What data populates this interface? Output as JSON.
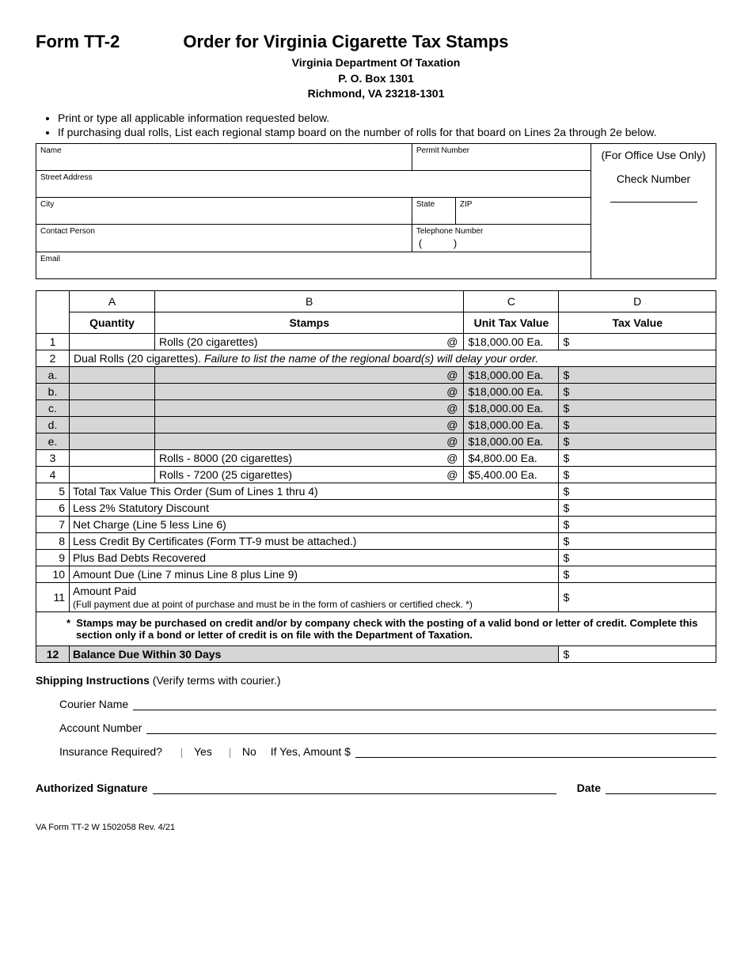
{
  "header": {
    "form_num": "Form TT-2",
    "title": "Order for Virginia Cigarette Tax Stamps",
    "dept": "Virginia Department Of Taxation",
    "pobox": "P. O. Box 1301",
    "citystate": "Richmond, VA  23218-1301"
  },
  "bullets": [
    "Print or type all applicable information requested below.",
    "If purchasing dual rolls, List each regional stamp board on the number of rolls for that board on Lines 2a through 2e below."
  ],
  "info_labels": {
    "name": "Name",
    "permit": "Permit Number",
    "office": "(For Office Use Only)",
    "check": "Check Number",
    "street": "Street Address",
    "city": "City",
    "state": "State",
    "zip": "ZIP",
    "contact": "Contact Person",
    "phone": "Telephone Number",
    "email": "Email"
  },
  "cols": {
    "A": "A",
    "B": "B",
    "C": "C",
    "D": "D",
    "qty": "Quantity",
    "stamps": "Stamps",
    "unit": "Unit Tax Value",
    "tax": "Tax Value"
  },
  "rows": {
    "r1": {
      "num": "1",
      "stamps": "Rolls (20 cigarettes)",
      "unit": "$18,000.00 Ea.",
      "d": "$"
    },
    "r2": {
      "num": "2",
      "text_a": "Dual Rolls (20 cigarettes).  ",
      "text_b": "Failure to list the name of the regional board(s) will delay your order."
    },
    "ra": {
      "num": "a.",
      "unit": "$18,000.00 Ea.",
      "d": "$"
    },
    "rb": {
      "num": "b.",
      "unit": "$18,000.00 Ea.",
      "d": "$"
    },
    "rc": {
      "num": "c.",
      "unit": "$18,000.00 Ea.",
      "d": "$"
    },
    "rd": {
      "num": "d.",
      "unit": "$18,000.00 Ea.",
      "d": "$"
    },
    "re": {
      "num": "e.",
      "unit": "$18,000.00 Ea.",
      "d": "$"
    },
    "r3": {
      "num": "3",
      "stamps": "Rolls - 8000 (20 cigarettes)",
      "unit": "$4,800.00 Ea.",
      "d": "$"
    },
    "r4": {
      "num": "4",
      "stamps": "Rolls - 7200 (25 cigarettes)",
      "unit": "$5,400.00 Ea.",
      "d": "$"
    },
    "r5": {
      "num": "5",
      "label": "Total Tax Value This Order (Sum of Lines 1 thru 4)",
      "d": "$"
    },
    "r6": {
      "num": "6",
      "label": "Less 2% Statutory Discount",
      "d": "$"
    },
    "r7": {
      "num": "7",
      "label": "Net Charge (Line 5 less Line 6)",
      "d": "$"
    },
    "r8": {
      "num": "8",
      "label": "Less Credit By Certificates (Form TT-9 must be attached.)",
      "d": "$"
    },
    "r9": {
      "num": "9",
      "label": "Plus Bad Debts Recovered",
      "d": "$"
    },
    "r10": {
      "num": "10",
      "label": "Amount Due (Line 7 minus Line 8 plus Line 9)",
      "d": "$"
    },
    "r11": {
      "num": "11",
      "label": "Amount Paid",
      "sub": "(Full payment due at point of purchase and must be in the form of cashiers or certified check. *)",
      "d": "$"
    },
    "note": "Stamps may be purchased on credit and/or by company check with the posting of a valid bond or letter of credit. Complete this section only if a bond or letter of credit is on file with the Department of Taxation.",
    "r12": {
      "num": "12",
      "label": "Balance Due Within 30 Days",
      "d": "$"
    }
  },
  "ship": {
    "head_a": "Shipping Instructions ",
    "head_b": "(Verify terms with courier.)",
    "courier": "Courier Name",
    "account": "Account Number",
    "ins": "Insurance Required?",
    "yes": "Yes",
    "no": "No",
    "ifyes": "If Yes, Amount  $"
  },
  "sig": {
    "auth": "Authorized Signature",
    "date": "Date"
  },
  "footer": "VA Form  TT-2 W    1502058    Rev. 4/21"
}
